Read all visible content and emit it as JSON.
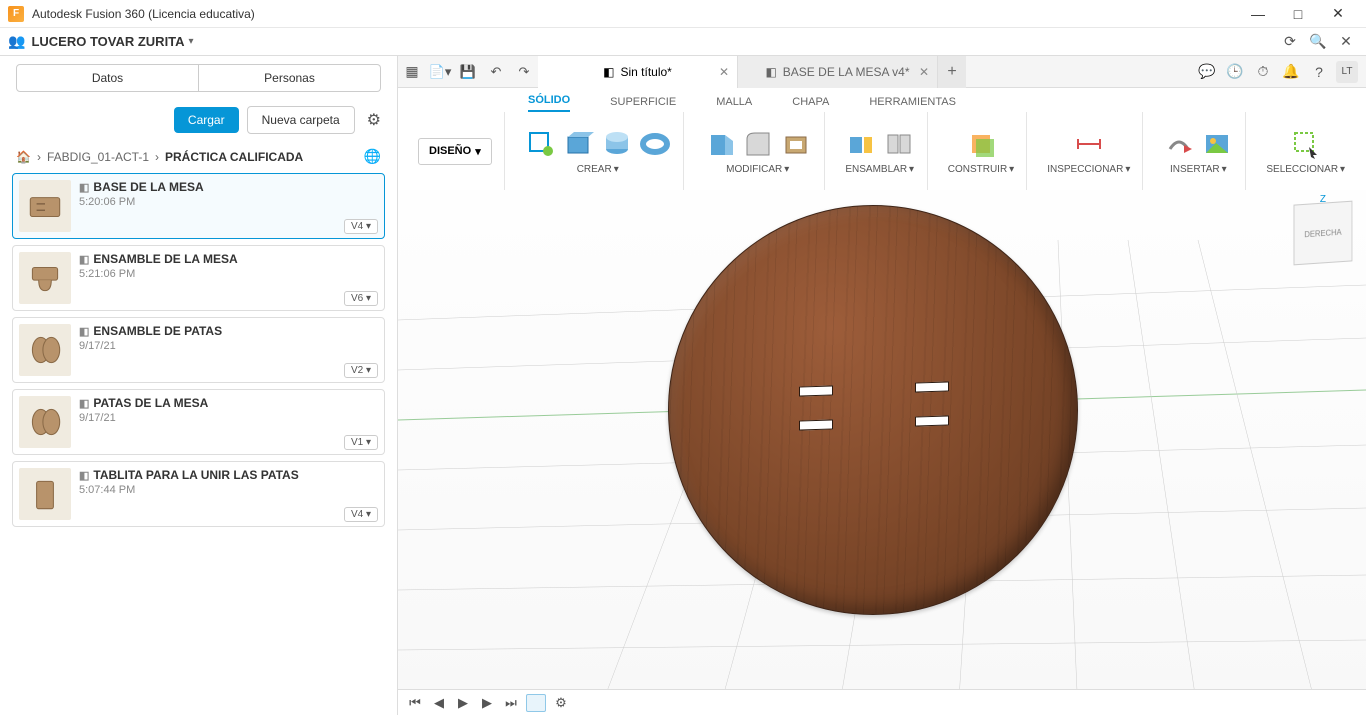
{
  "window": {
    "title": "Autodesk Fusion 360 (Licencia educativa)"
  },
  "team": {
    "name": "LUCERO TOVAR ZURITA"
  },
  "sidebar": {
    "tabs": {
      "data": "Datos",
      "people": "Personas"
    },
    "actions": {
      "upload": "Cargar",
      "newfolder": "Nueva carpeta"
    },
    "breadcrumb": {
      "folder": "FABDIG_01-ACT-1",
      "current": "PRÁCTICA CALIFICADA"
    },
    "items": [
      {
        "title": "BASE DE LA MESA",
        "meta": "5:20:06 PM",
        "version": "V4"
      },
      {
        "title": "ENSAMBLE DE LA MESA",
        "meta": "5:21:06 PM",
        "version": "V6"
      },
      {
        "title": "ENSAMBLE DE PATAS",
        "meta": "9/17/21",
        "version": "V2"
      },
      {
        "title": "PATAS DE LA MESA",
        "meta": "9/17/21",
        "version": "V1"
      },
      {
        "title": "TABLITA PARA LA UNIR LAS PATAS",
        "meta": "5:07:44 PM",
        "version": "V4"
      }
    ]
  },
  "tabs": {
    "doc1": "Sin título*",
    "doc2": "BASE DE LA MESA v4*"
  },
  "avatar": "LT",
  "ribbon": {
    "design": "DISEÑO",
    "tabs": {
      "solid": "SÓLIDO",
      "surface": "SUPERFICIE",
      "mesh": "MALLA",
      "sheet": "CHAPA",
      "tools": "HERRAMIENTAS"
    },
    "groups": {
      "create": "CREAR",
      "modify": "MODIFICAR",
      "assemble": "ENSAMBLAR",
      "construct": "CONSTRUIR",
      "inspect": "INSPECCIONAR",
      "insert": "INSERTAR",
      "select": "SELECCIONAR"
    }
  },
  "viewcube": "DERECHA"
}
